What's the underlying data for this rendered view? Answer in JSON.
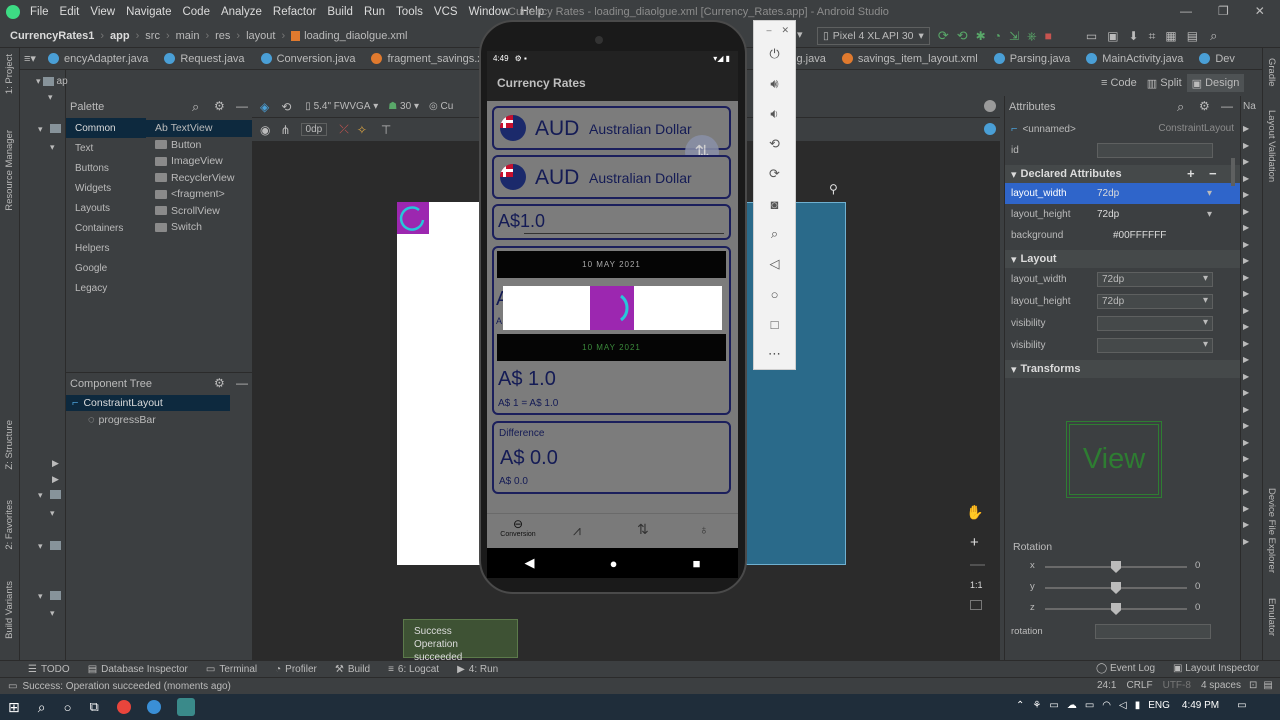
{
  "window": {
    "title": "Currency Rates - loading_diaolgue.xml [Currency_Rates.app] - Android Studio",
    "menu": [
      "File",
      "Edit",
      "View",
      "Navigate",
      "Code",
      "Analyze",
      "Refactor",
      "Build",
      "Run",
      "Tools",
      "VCS",
      "Window",
      "Help"
    ]
  },
  "navbar": {
    "breadcrumbs": [
      "CurrencyRates1",
      "app",
      "src",
      "main",
      "res",
      "layout",
      "loading_diaolgue.xml"
    ],
    "device": "Pixel 4 XL API 30"
  },
  "tabs": [
    {
      "label": "encyAdapter.java",
      "color": "#4a9fd6"
    },
    {
      "label": "Request.java",
      "color": "#4a9fd6"
    },
    {
      "label": "Conversion.java",
      "color": "#4a9fd6"
    },
    {
      "label": "fragment_savings.xml",
      "color": "#e07a2e"
    },
    {
      "label": "Dialog.java",
      "color": "#4a9fd6"
    },
    {
      "label": "savings_item_layout.xml",
      "color": "#e07a2e"
    },
    {
      "label": "Parsing.java",
      "color": "#4a9fd6"
    },
    {
      "label": "MainActivity.java",
      "color": "#4a9fd6"
    },
    {
      "label": "Dev",
      "color": "#4a9fd6"
    }
  ],
  "left_strip": [
    "1: Project",
    "Resource Manager",
    "Z: Structure",
    "2: Favorites",
    "Build Variants"
  ],
  "project_root": "ap",
  "palette": {
    "title": "Palette",
    "categories": [
      "Common",
      "Text",
      "Buttons",
      "Widgets",
      "Layouts",
      "Containers",
      "Helpers",
      "Google",
      "Legacy"
    ],
    "items": [
      "Ab TextView",
      "Button",
      "ImageView",
      "RecyclerView",
      "<fragment>",
      "ScrollView",
      "Switch"
    ]
  },
  "component_tree": {
    "title": "Component Tree",
    "nodes": [
      "ConstraintLayout",
      "progressBar"
    ]
  },
  "design_toolbar": {
    "device": "5.4\" FWVGA",
    "api": "30",
    "theme": "Cu",
    "margin": "0dp"
  },
  "view_modes": [
    "Code",
    "Split",
    "Design"
  ],
  "phone": {
    "status_time": "4:49",
    "app_title": "Currency Rates",
    "rows": [
      {
        "code": "AUD",
        "name": "Australian Dollar"
      },
      {
        "code": "AUD",
        "name": "Australian Dollar"
      }
    ],
    "amount_input": "A$1.0",
    "date_top": "10 MAY 2021",
    "date_bottom": "10 MAY 2021",
    "letter_a": "A",
    "letter_a_small": "A",
    "result_big": "A$ 1.0",
    "result_small": "A$ 1 = A$ 1.0",
    "difference_label": "Difference",
    "difference_big": "A$ 0.0",
    "difference_small": "A$ 0.0",
    "bottom_nav_label": "Conversion"
  },
  "attributes": {
    "title": "Attributes",
    "element_name": "<unnamed>",
    "element_type": "ConstraintLayout",
    "id_label": "id",
    "declared_title": "Declared Attributes",
    "declared": [
      {
        "k": "layout_width",
        "v": "72dp"
      },
      {
        "k": "layout_height",
        "v": "72dp"
      },
      {
        "k": "background",
        "v": "#00FFFFFF"
      }
    ],
    "layout_title": "Layout",
    "layout": [
      {
        "k": "layout_width",
        "v": "72dp"
      },
      {
        "k": "layout_height",
        "v": "72dp"
      },
      {
        "k": "visibility",
        "v": ""
      },
      {
        "k": "visibility",
        "v": ""
      }
    ],
    "transforms_title": "Transforms",
    "view_preview": "View",
    "rotation_title": "Rotation",
    "rotation": [
      {
        "axis": "x",
        "value": "0",
        "level": 0.5
      },
      {
        "axis": "y",
        "value": "0",
        "level": 0.5
      },
      {
        "axis": "z",
        "value": "0",
        "level": 0.5
      }
    ],
    "rotation_field_label": "rotation"
  },
  "right_strip": [
    "Gradle",
    "Layout Validation",
    "Device File Explorer",
    "Emulator"
  ],
  "right_col_label": "Na",
  "zoom_ratio": "1:1",
  "toast": {
    "title": "Success",
    "message": "Operation succeeded"
  },
  "bottom_tools": [
    "TODO",
    "Database Inspector",
    "Terminal",
    "Profiler",
    "Build",
    "6: Logcat",
    "4: Run"
  ],
  "bottom_right_tools": [
    "Event Log",
    "Layout Inspector"
  ],
  "status": {
    "message": "Success: Operation succeeded (moments ago)",
    "position": "24:1",
    "line_sep": "CRLF",
    "encoding": "UTF-8",
    "indent": "4 spaces"
  },
  "taskbar": {
    "lang": "ENG",
    "time": "4:49 PM"
  },
  "colors": {
    "accent": "#9c27b0",
    "spinner": "#26c6da",
    "selection": "#2f65ca",
    "blueprint": "#2a6a8a"
  }
}
